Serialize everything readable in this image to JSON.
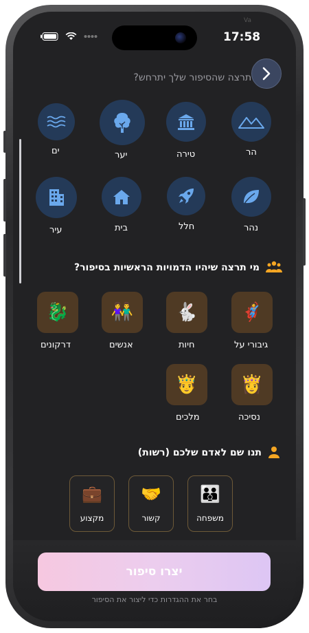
{
  "status_bar": {
    "time": "17:58",
    "ghost_text": "Va"
  },
  "location_section": {
    "title": "איפה תרצה שהסיפור שלך יתרחש?",
    "items": [
      {
        "label": "הר",
        "icon": "mountain-icon"
      },
      {
        "label": "טירה",
        "icon": "castle-icon"
      },
      {
        "label": "יער",
        "icon": "tree-icon"
      },
      {
        "label": "ים",
        "icon": "waves-icon"
      },
      {
        "label": "נהר",
        "icon": "leaf-icon"
      },
      {
        "label": "חלל",
        "icon": "rocket-icon"
      },
      {
        "label": "בית",
        "icon": "house-icon"
      },
      {
        "label": "עיר",
        "icon": "city-icon"
      }
    ]
  },
  "characters_section": {
    "title": "מי תרצה שיהיו הדמויות הראשיות בסיפור?",
    "icon": "people-icon",
    "items": [
      {
        "label": "גיבורי על",
        "emoji": "🦸"
      },
      {
        "label": "חיות",
        "emoji": "🐇"
      },
      {
        "label": "אנשים",
        "emoji": "👫"
      },
      {
        "label": "דרקונים",
        "emoji": "🐉"
      },
      {
        "label": "נסיכה",
        "emoji": "👸"
      },
      {
        "label": "מלכים",
        "emoji": "🤴"
      }
    ]
  },
  "name_section": {
    "title": "תנו שם לאדם שלכם (רשות)",
    "icon": "person-icon",
    "items": [
      {
        "label": "משפחה",
        "emoji": "👪"
      },
      {
        "label": "קשור",
        "emoji": "🤝"
      },
      {
        "label": "מקצוע",
        "emoji": "💼"
      }
    ]
  },
  "create_button": {
    "label": "יצרו סיפור"
  },
  "hint": "בחר את ההגדרות כדי ליצור את הסיפור",
  "colors": {
    "accent_orange": "#f5a623",
    "icon_blue": "#6aa8ec",
    "tile_brown": "#4f3a24"
  }
}
